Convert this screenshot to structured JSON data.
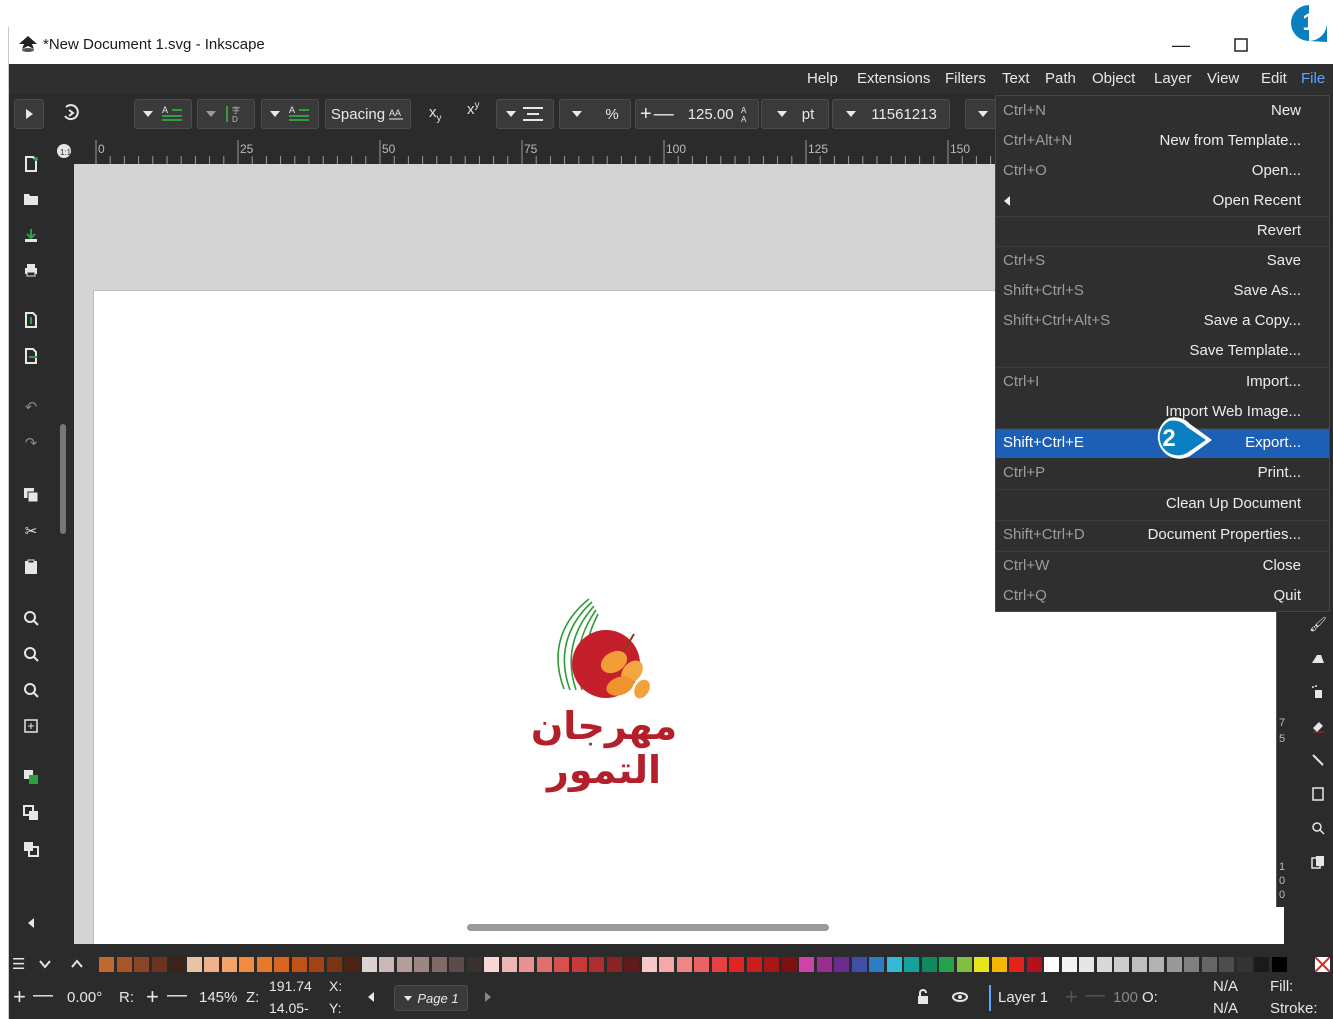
{
  "window": {
    "title": "*New Document 1.svg - Inkscape"
  },
  "menubar": {
    "items": [
      "Help",
      "Extensions",
      "Filters",
      "Text",
      "Path",
      "Object",
      "Layer",
      "View",
      "Edit",
      "File"
    ],
    "active": "File"
  },
  "toolbar": {
    "spacing_label": "Spacing",
    "percent_label": "%",
    "font_size_value": "125.00",
    "unit_label": "pt",
    "field_value": "11561213"
  },
  "ruler": {
    "ticks": [
      "0",
      "25",
      "50",
      "75",
      "100",
      "125",
      "150"
    ]
  },
  "ruler_left": {
    "ticks_a": [
      "7",
      "5"
    ],
    "ticks_b": [
      "1",
      "0",
      "0"
    ]
  },
  "canvas": {
    "logo_text": "مهرجان التمور"
  },
  "file_menu": {
    "items": [
      {
        "shortcut": "Ctrl+N",
        "label": "New"
      },
      {
        "shortcut": "Ctrl+Alt+N",
        "label": "New from Template..."
      },
      {
        "shortcut": "Ctrl+O",
        "label": "Open..."
      },
      {
        "shortcut": "",
        "label": "Open Recent"
      },
      {
        "shortcut": "",
        "label": "Revert"
      },
      {
        "shortcut": "Ctrl+S",
        "label": "Save"
      },
      {
        "shortcut": "Shift+Ctrl+S",
        "label": "Save As..."
      },
      {
        "shortcut": "Shift+Ctrl+Alt+S",
        "label": "Save a Copy..."
      },
      {
        "shortcut": "",
        "label": "Save Template..."
      },
      {
        "shortcut": "Ctrl+I",
        "label": "Import..."
      },
      {
        "shortcut": "",
        "label": "Import Web Image..."
      },
      {
        "shortcut": "Shift+Ctrl+E",
        "label": "Export..."
      },
      {
        "shortcut": "Ctrl+P",
        "label": "Print..."
      },
      {
        "shortcut": "",
        "label": "Clean Up Document"
      },
      {
        "shortcut": "Shift+Ctrl+D",
        "label": "Document Properties..."
      },
      {
        "shortcut": "Ctrl+W",
        "label": "Close"
      },
      {
        "shortcut": "Ctrl+Q",
        "label": "Quit"
      }
    ],
    "highlighted": "Export..."
  },
  "callouts": {
    "first": "1",
    "second": "2",
    "color": "#0a7fc1"
  },
  "status": {
    "rotation": "0.00°",
    "r_label": "R:",
    "zoom": "145%",
    "z_label": "Z:",
    "x_value": "191.74",
    "y_value": "14.05-",
    "x_label": "X:",
    "y_label": "Y:",
    "page_label": "Page 1",
    "layer_label": "Layer 1",
    "opacity_value": "100",
    "opacity_label": "O:",
    "fill_value": "N/A",
    "stroke_value": "N/A",
    "fill_label": "Fill:",
    "stroke_label": "Stroke:"
  },
  "palette": {
    "colors": [
      "#c0692f",
      "#a8552a",
      "#8a4526",
      "#6a3420",
      "#3c2218",
      "#e8c3a7",
      "#f0b08a",
      "#f3a36a",
      "#f18b42",
      "#e8782a",
      "#d9651e",
      "#c25317",
      "#a24314",
      "#7c3410",
      "#4a2410",
      "#dcd3d0",
      "#c9b8b3",
      "#b29d98",
      "#9c8681",
      "#7e6a66",
      "#5c4c49",
      "#3a302e",
      "#f6d7d6",
      "#f0b6b4",
      "#e89391",
      "#e0706e",
      "#d8504d",
      "#c8393a",
      "#ad2e2f",
      "#8c2426",
      "#5e1a1c",
      "#f9c9c9",
      "#f6a8a8",
      "#f18584",
      "#ec6262",
      "#e84040",
      "#e22424",
      "#cc1d1d",
      "#a81616",
      "#801010",
      "#cc44aa",
      "#9b2d8f",
      "#6a2c91",
      "#3f4fa8",
      "#2f7bc4",
      "#35b7d6",
      "#14a39a",
      "#0f8a5f",
      "#22a34a",
      "#7fc041",
      "#e6e619",
      "#f2b707",
      "#e2231a",
      "#b4121a",
      "#ffffff",
      "#f2f2f2",
      "#e6e6e6",
      "#d9d9d9",
      "#cccccc",
      "#bfbfbf",
      "#b3b3b3",
      "#999999",
      "#808080",
      "#666666",
      "#4d4d4d",
      "#333333",
      "#1a1a1a",
      "#000000"
    ]
  }
}
